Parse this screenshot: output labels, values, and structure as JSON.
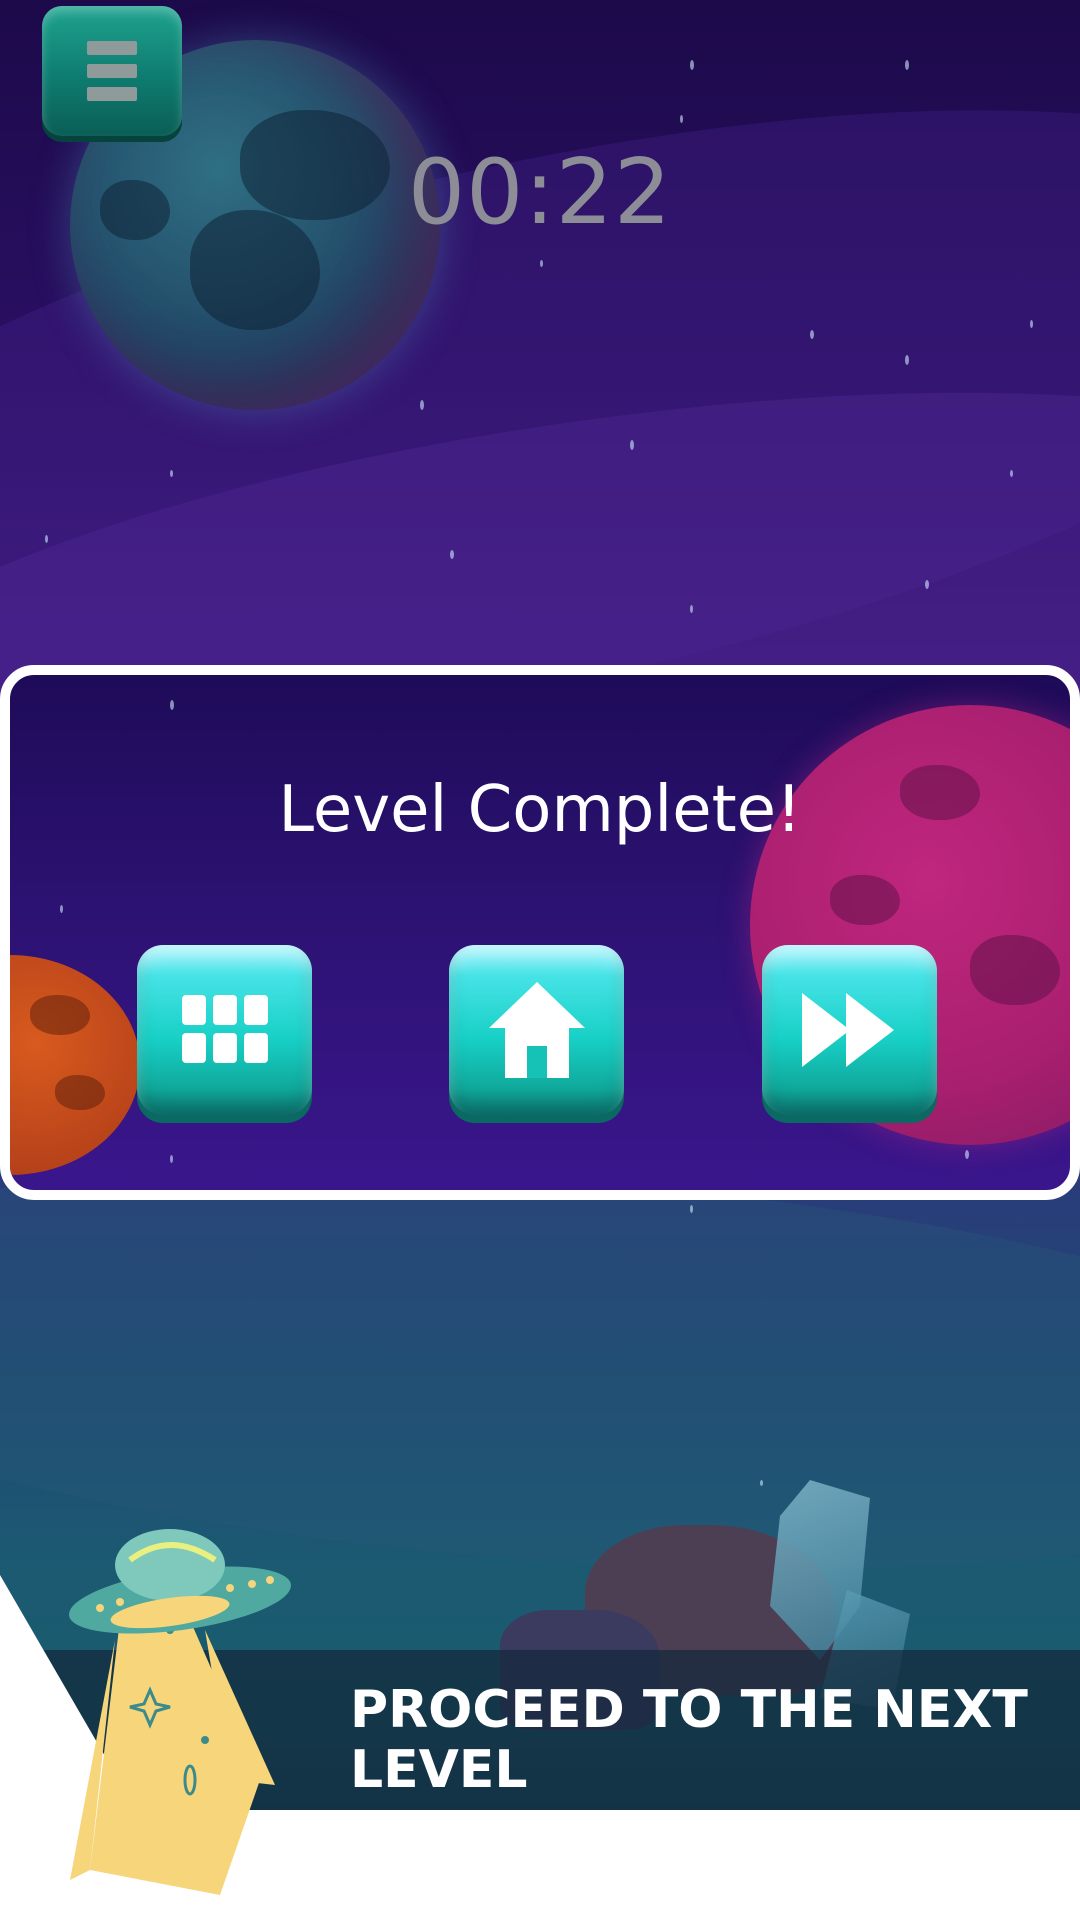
{
  "timer": {
    "value": "00:22"
  },
  "dialog": {
    "title": "Level Complete!"
  },
  "buttons": {
    "menu": "menu-icon",
    "levels": "grid-icon",
    "home": "home-icon",
    "next": "fast-forward-icon"
  },
  "banner": {
    "text": "PROCEED TO THE NEXT LEVEL"
  },
  "colors": {
    "button_teal": "#18d0c6",
    "dialog_border": "#ffffff",
    "banner_text": "#ffffff",
    "timer_text": "#8d8d97"
  }
}
